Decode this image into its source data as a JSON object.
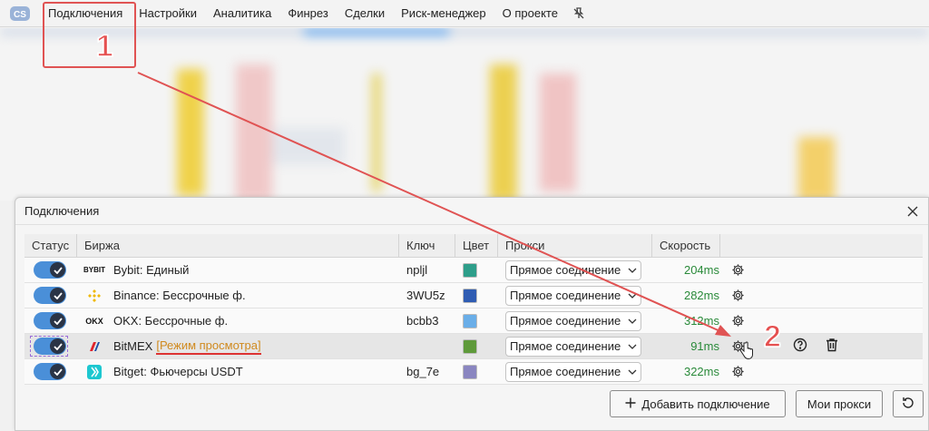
{
  "menu": {
    "items": [
      "Подключения",
      "Настройки",
      "Аналитика",
      "Финрез",
      "Сделки",
      "Риск-менеджер",
      "О проекте"
    ]
  },
  "panel": {
    "title": "Подключения",
    "columns": {
      "status": "Статус",
      "exchange": "Биржа",
      "key": "Ключ",
      "color": "Цвет",
      "proxy": "Прокси",
      "speed": "Скорость"
    },
    "rows": [
      {
        "icon": "bybit-logo-icon",
        "logo_text": "BYBIT",
        "name": "Bybit: Единый",
        "mode": "",
        "key": "npljl",
        "color": "#2e9e8a",
        "proxy": "Прямое соединение",
        "speed": "204ms",
        "selected": false
      },
      {
        "icon": "binance-logo-icon",
        "logo_text": "",
        "name": "Binance: Бессрочные ф.",
        "mode": "",
        "key": "3WU5z",
        "color": "#2f5cb3",
        "proxy": "Прямое соединение",
        "speed": "282ms",
        "selected": false
      },
      {
        "icon": "okx-logo-icon",
        "logo_text": "OKX",
        "name": "OKX: Бессрочные ф.",
        "mode": "",
        "key": "bcbb3",
        "color": "#6aaee8",
        "proxy": "Прямое соединение",
        "speed": "312ms",
        "selected": false
      },
      {
        "icon": "bitmex-logo-icon",
        "logo_text": "",
        "name": "BitMEX",
        "mode": "[Режим просмотра]",
        "key": "",
        "color": "#5e9a3a",
        "proxy": "Прямое соединение",
        "speed": "91ms",
        "selected": true
      },
      {
        "icon": "bitget-logo-icon",
        "logo_text": "",
        "name": "Bitget: Фьючерсы USDT",
        "mode": "",
        "key": "bg_7e",
        "color": "#8a86c0",
        "proxy": "Прямое соединение",
        "speed": "322ms",
        "selected": false
      }
    ],
    "buttons": {
      "add": "Добавить подключение",
      "proxies": "Мои прокси"
    }
  },
  "annotations": {
    "step1": "1",
    "step2": "2"
  },
  "colors": {
    "toggle_on": "#4a8fd8",
    "speed_text": "#2a8a3a",
    "mode_text": "#d08a1f",
    "annotation": "#e05353"
  }
}
